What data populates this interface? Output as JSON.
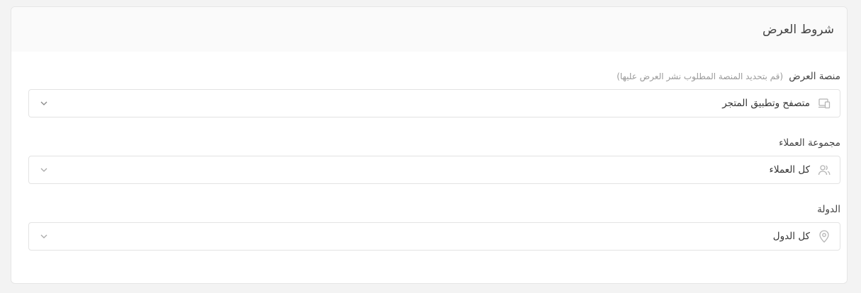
{
  "section": {
    "title": "شروط العرض"
  },
  "fields": [
    {
      "label": "منصة العرض",
      "hint": "(قم بتحديد المنصة المطلوب نشر العرض عليها)",
      "value": "متصفح وتطبيق المتجر",
      "icon": "devices-icon"
    },
    {
      "label": "مجموعة العملاء",
      "value": "كل العملاء",
      "icon": "users-icon"
    },
    {
      "label": "الدولة",
      "value": "كل الدول",
      "icon": "location-pin-icon"
    }
  ],
  "colors": {
    "background": "#f3f3f3",
    "header": "#fafafa",
    "border": "#e3e3e3",
    "icon": "#b5b5b5"
  }
}
